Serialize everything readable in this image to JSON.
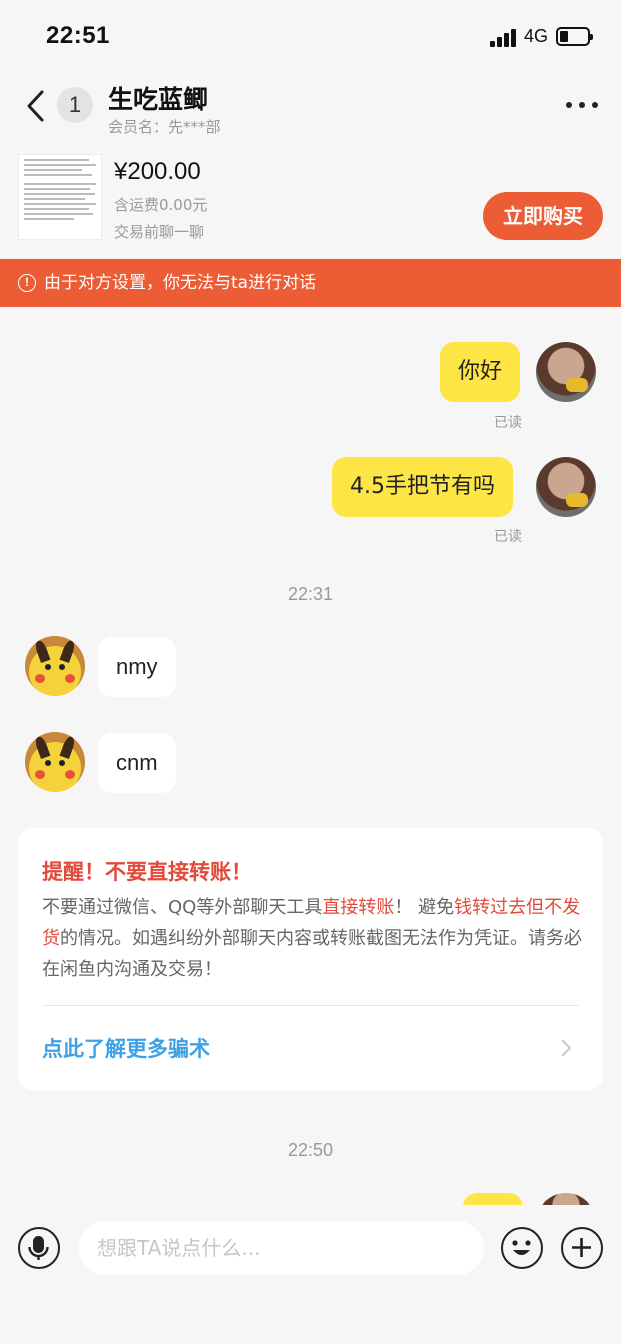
{
  "status_bar": {
    "time": "22:51",
    "network": "4G"
  },
  "header": {
    "unread_count": "1",
    "contact_name": "生吃蓝鲫",
    "member_label": "会员名：先***部"
  },
  "product": {
    "price": "¥200.00",
    "shipping": "含运费0.00元",
    "note": "交易前聊一聊",
    "buy_label": "立即购买"
  },
  "warning": {
    "text": "由于对方设置，你无法与ta进行对话"
  },
  "messages": [
    {
      "text": "你好",
      "read": "已读"
    },
    {
      "text": "4.5手把节有吗",
      "read": "已读"
    },
    {
      "time": "22:31"
    },
    {
      "text": "nmy"
    },
    {
      "text": "cnm"
    }
  ],
  "tip": {
    "title": "提醒！不要直接转账！",
    "body_1": "不要通过微信、QQ等外部聊天工具",
    "body_red_1": "直接转账",
    "body_2": "！ 避免",
    "body_red_2": "钱转过去但不发货",
    "body_3": "的情况。如遇纠纷外部聊天内容或转账截图无法作为凭证。请务必在闲鱼内沟通及交易！",
    "link": "点此了解更多骗术"
  },
  "time_2": "22:50",
  "input": {
    "placeholder": "想跟TA说点什么..."
  },
  "colors": {
    "accent": "#ec5d36",
    "my_bubble": "#fde546",
    "link": "#3ea1e6",
    "alert_red": "#e24a3b"
  }
}
